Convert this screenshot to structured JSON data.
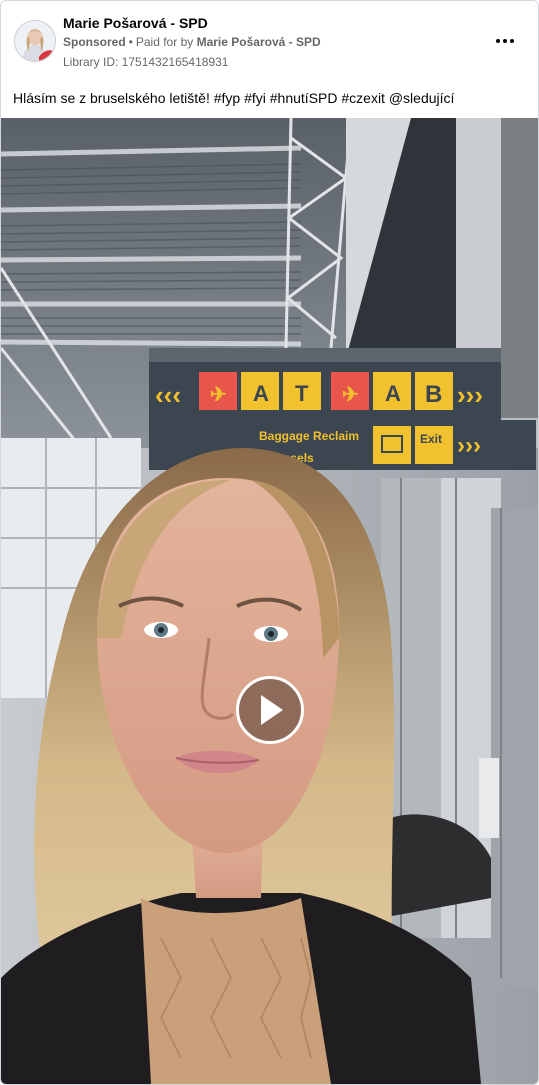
{
  "post": {
    "page_name": "Marie Pošarová - SPD",
    "sponsored_label": "Sponsored",
    "paid_for_prefix": "Paid for by",
    "paid_for_by": "Marie Pošarová - SPD",
    "library_id": "Library ID: 1751432165418931",
    "caption": "Hlásím se z bruselského letiště! #fyp #fyi #hnutíSPD #czexit @sledující"
  },
  "video": {
    "sign": {
      "gate_left_arrows": "‹‹‹",
      "gate_a": "A",
      "gate_t": "T",
      "gate_a2": "A",
      "gate_b": "B",
      "gate_right_arrows": "›››",
      "baggage_line1": "Baggage Reclaim",
      "baggage_line2": "Brussels",
      "exit_label": "Exit",
      "exit_arrows": "›››"
    },
    "play_icon": "play-icon"
  },
  "icons": {
    "more": "more-options-icon",
    "avatar": "profile-avatar"
  },
  "colors": {
    "sign_yellow": "#f2c12e",
    "sign_red": "#e8554a",
    "sign_dark": "#3c4650",
    "text_secondary": "#65676b"
  }
}
